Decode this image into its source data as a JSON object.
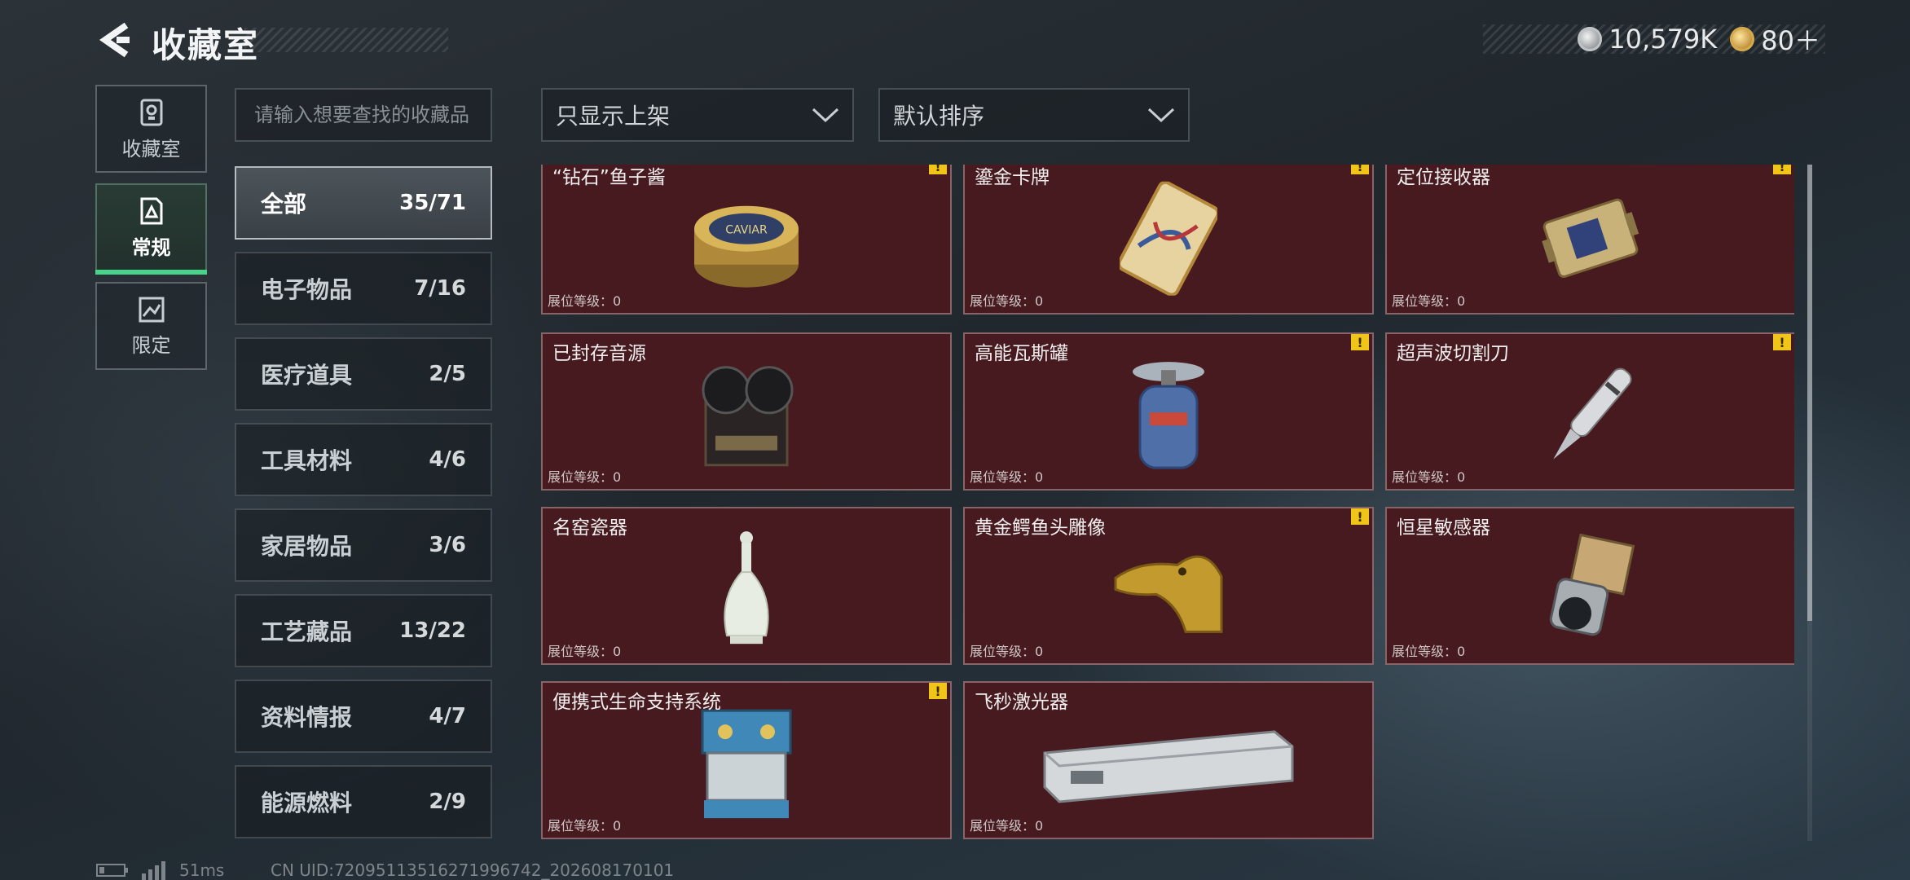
{
  "header": {
    "title": "收藏室",
    "currency": [
      {
        "icon": "silver-coin-icon",
        "value": "10,579K"
      },
      {
        "icon": "gold-coin-icon",
        "value": "80＋"
      }
    ]
  },
  "left_tabs": [
    {
      "icon": "collection-room-icon",
      "label": "收藏室",
      "active": false
    },
    {
      "icon": "regular-icon",
      "label": "常规",
      "active": true
    },
    {
      "icon": "limited-icon",
      "label": "限定",
      "active": false
    }
  ],
  "search": {
    "placeholder": "请输入想要查找的收藏品"
  },
  "categories": [
    {
      "name": "全部",
      "count": "35/71",
      "active": true
    },
    {
      "name": "电子物品",
      "count": "7/16"
    },
    {
      "name": "医疗道具",
      "count": "2/5"
    },
    {
      "name": "工具材料",
      "count": "4/6"
    },
    {
      "name": "家居物品",
      "count": "3/6"
    },
    {
      "name": "工艺藏品",
      "count": "13/22"
    },
    {
      "name": "资料情报",
      "count": "4/7"
    },
    {
      "name": "能源燃料",
      "count": "2/9"
    }
  ],
  "filters": {
    "show_filter": "只显示上架",
    "sort": "默认排序"
  },
  "items": [
    {
      "name": "“钻石”鱼子酱",
      "level": "展位等级：0",
      "warning": true,
      "art": "caviar"
    },
    {
      "name": "鎏金卡牌",
      "level": "展位等级：0",
      "warning": true,
      "art": "card"
    },
    {
      "name": "定位接收器",
      "level": "展位等级：0",
      "warning": true,
      "art": "receiver"
    },
    {
      "name": "已封存音源",
      "level": "展位等级：0",
      "warning": false,
      "art": "recorder"
    },
    {
      "name": "高能瓦斯罐",
      "level": "展位等级：0",
      "warning": true,
      "art": "gas"
    },
    {
      "name": "超声波切割刀",
      "level": "展位等级：0",
      "warning": true,
      "art": "knife"
    },
    {
      "name": "名窑瓷器",
      "level": "展位等级：0",
      "warning": false,
      "art": "vase"
    },
    {
      "name": "黄金鳄鱼头雕像",
      "level": "展位等级：0",
      "warning": true,
      "art": "croc"
    },
    {
      "name": "恒星敏感器",
      "level": "展位等级：0",
      "warning": false,
      "art": "sensor"
    },
    {
      "name": "便携式生命支持系统",
      "level": "展位等级：0",
      "warning": true,
      "art": "lifesupport"
    },
    {
      "name": "飞秒激光器",
      "level": "展位等级：0",
      "warning": false,
      "art": "laser"
    }
  ],
  "footer": {
    "ping": "51ms",
    "uid": "CN UID:7209511351627199674​2_202608170101"
  },
  "colors": {
    "card_bg": "#471a1f",
    "active_tab": "#47d48a",
    "warning": "#f0c419"
  }
}
